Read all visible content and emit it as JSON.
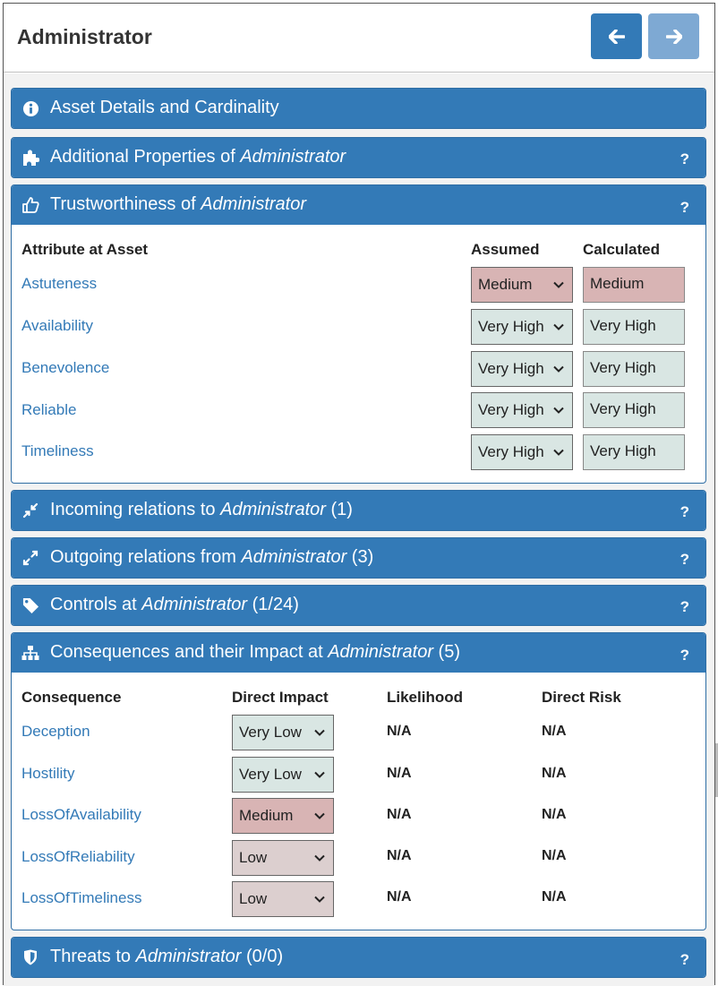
{
  "header": {
    "title": "Administrator"
  },
  "colors": {
    "primary": "#337ab7",
    "primary_light": "#7ea9d3",
    "medium_bg": "#d8b4b4",
    "high_bg": "#d9e6e3",
    "low_bg": "#dccfcf",
    "link": "#337ab7"
  },
  "panels": {
    "asset_details": {
      "label": "Asset Details and Cardinality",
      "icon": "info-circle-icon"
    },
    "additional_properties": {
      "prefix": "Additional Properties of ",
      "asset": "Administrator",
      "suffix": "",
      "help": "?",
      "icon": "puzzle-icon"
    },
    "trustworthiness": {
      "prefix": "Trustworthiness of ",
      "asset": "Administrator",
      "suffix": "",
      "help": "?",
      "icon": "thumbs-up-icon"
    },
    "incoming": {
      "prefix": "Incoming relations to ",
      "asset": "Administrator",
      "suffix": " (1)",
      "help": "?",
      "icon": "compress-arrows-icon"
    },
    "outgoing": {
      "prefix": "Outgoing relations from ",
      "asset": "Administrator",
      "suffix": " (3)",
      "help": "?",
      "icon": "expand-arrows-icon"
    },
    "controls": {
      "prefix": "Controls at ",
      "asset": "Administrator",
      "suffix": " (1/24)",
      "help": "?",
      "icon": "tag-icon"
    },
    "consequences": {
      "prefix": "Consequences and their Impact at ",
      "asset": "Administrator",
      "suffix": " (5)",
      "help": "?",
      "icon": "sitemap-icon"
    },
    "threats": {
      "prefix": "Threats to ",
      "asset": "Administrator",
      "suffix": " (0/0)",
      "help": "?",
      "icon": "shield-icon"
    }
  },
  "trust_table": {
    "headers": {
      "attribute": "Attribute at Asset",
      "assumed": "Assumed",
      "calculated": "Calculated"
    },
    "rows": [
      {
        "attribute": "Astuteness",
        "assumed": "Medium",
        "calculated": "Medium",
        "level": "medium"
      },
      {
        "attribute": "Availability",
        "assumed": "Very High",
        "calculated": "Very High",
        "level": "high"
      },
      {
        "attribute": "Benevolence",
        "assumed": "Very High",
        "calculated": "Very High",
        "level": "high"
      },
      {
        "attribute": "Reliable",
        "assumed": "Very High",
        "calculated": "Very High",
        "level": "high"
      },
      {
        "attribute": "Timeliness",
        "assumed": "Very High",
        "calculated": "Very High",
        "level": "high"
      }
    ]
  },
  "consequence_table": {
    "headers": {
      "consequence": "Consequence",
      "impact": "Direct Impact",
      "likelihood": "Likelihood",
      "risk": "Direct Risk"
    },
    "rows": [
      {
        "name": "Deception",
        "impact": "Very Low",
        "likelihood": "N/A",
        "risk": "N/A",
        "level": "verylow"
      },
      {
        "name": "Hostility",
        "impact": "Very Low",
        "likelihood": "N/A",
        "risk": "N/A",
        "level": "verylow"
      },
      {
        "name": "LossOfAvailability",
        "impact": "Medium",
        "likelihood": "N/A",
        "risk": "N/A",
        "level": "medium"
      },
      {
        "name": "LossOfReliability",
        "impact": "Low",
        "likelihood": "N/A",
        "risk": "N/A",
        "level": "low"
      },
      {
        "name": "LossOfTimeliness",
        "impact": "Low",
        "likelihood": "N/A",
        "risk": "N/A",
        "level": "low"
      }
    ]
  }
}
